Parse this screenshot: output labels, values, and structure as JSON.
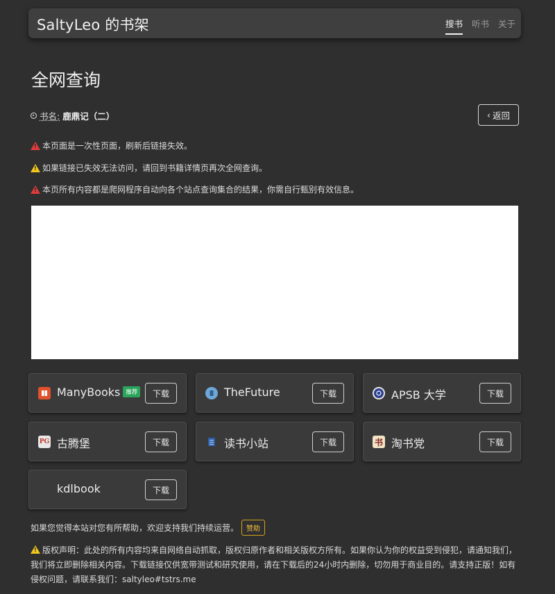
{
  "header": {
    "brand": "SaltyLeo 的书架",
    "nav": [
      {
        "label": "搜书",
        "active": true
      },
      {
        "label": "听书",
        "active": false
      },
      {
        "label": "关于",
        "active": false
      }
    ]
  },
  "page": {
    "title": "全网查询",
    "book_label": "书名:",
    "book_name": "鹿鼎记（二）",
    "back_label": "返回"
  },
  "notices": [
    {
      "level": "red",
      "text": "本页面是一次性页面，刷新后链接失效。"
    },
    {
      "level": "yellow",
      "text": "如果链接已失效无法访问，请回到书籍详情页再次全网查询。"
    },
    {
      "level": "red",
      "text": "本页所有内容都是爬网程序自动向各个站点查询集合的结果，你需自行甄别有效信息。"
    }
  ],
  "sources": [
    {
      "name": "ManyBooks",
      "badge": "推荐",
      "icon": "manybooks-icon",
      "icon_color": "#e0512e",
      "icon_glyph": "▮▮",
      "download": "下载"
    },
    {
      "name": "TheFuture",
      "badge": "",
      "icon": "thefuture-icon",
      "icon_color": "#6fa8d8",
      "icon_glyph": "▯",
      "download": "下载"
    },
    {
      "name": "APSB 大学",
      "badge": "",
      "icon": "apsb-icon",
      "icon_color": "#2c3e8f",
      "icon_glyph": "◉",
      "download": "下载"
    },
    {
      "name": "古腾堡",
      "badge": "",
      "icon": "gutenberg-icon",
      "icon_color": "#e8e8e8",
      "icon_glyph": "PG",
      "download": "下载"
    },
    {
      "name": "读书小站",
      "badge": "",
      "icon": "dushu-icon",
      "icon_color": "#2f5fa8",
      "icon_glyph": "≡",
      "download": "下载"
    },
    {
      "name": "淘书党",
      "badge": "",
      "icon": "taoshudang-icon",
      "icon_color": "#f1e4c4",
      "icon_glyph": "书",
      "download": "下载"
    },
    {
      "name": "kdlbook",
      "badge": "",
      "icon": "",
      "icon_color": "",
      "icon_glyph": "",
      "download": "下载"
    }
  ],
  "footer": {
    "support_text": "如果您觉得本站对您有所帮助，欢迎支持我们持续运营。",
    "sponsor_label": "赞助",
    "copyright_text": "版权声明：此处的所有内容均来自网络自动抓取，版权归原作者和相关版权方所有。如果你认为你的权益受到侵犯，请通知我们，我们将立即删除相关内容。下载链接仅供宽带测试和研究使用，请在下载后的24小时内删除，切勿用于商业目的。请支持正版！如有侵权问题，请联系我们：saltyleo#tstrs.me"
  },
  "colors": {
    "background": "#2f2f2f",
    "navbar": "#3f3f3f",
    "card": "#3a3a3a",
    "badge_green": "#2aa45b",
    "warn_red": "#e03c3c",
    "warn_yellow": "#f2c81c",
    "sponsor_gold": "#d6a31d"
  }
}
